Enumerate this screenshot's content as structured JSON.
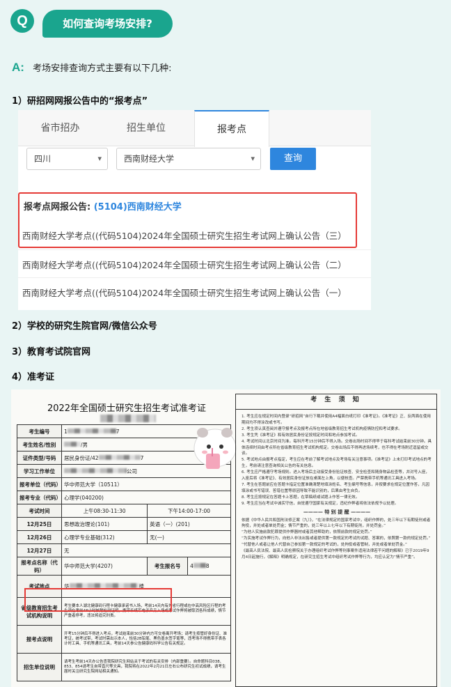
{
  "header": {
    "q_mark": "Q",
    "question": "如何查询考场安排?"
  },
  "answer": {
    "a_mark": "A:",
    "text": "考场安排查询方式主要有以下几种:"
  },
  "steps": {
    "s1": "1）研招网网报公告中的“报考点”",
    "s2": "2）学校的研究生院官网/微信公众号",
    "s3": "3）教育考试院官网",
    "s4": "4）准考证"
  },
  "portal": {
    "tabs": [
      "省市招办",
      "招生单位",
      "报考点"
    ],
    "active_tab": 2,
    "province": "四川",
    "school": "西南财经大学",
    "query_button": "查询",
    "notice_label": "报考点网报公告:",
    "notice_code": "(5104)西南财经大学",
    "notices": [
      "西南财经大学考点((代码5104)2024年全国硕士研究生招生考试网上确认公告（三）",
      "西南财经大学考点((代码5104)2024年全国硕士研究生招生考试网上确认公告（二）",
      "西南财经大学考点((代码5104)2024年全国硕士研究生招生考试网上确认公告（一）"
    ]
  },
  "ticket": {
    "title": "2022年全国硕士研究生招生考试准考证",
    "rows": {
      "exam_no_label": "考生编号",
      "exam_no": "1",
      "exam_no_tail": "7",
      "name_label": "考生姓名/性别",
      "name_tail": "/男",
      "id_label": "证件类型/号码",
      "id_value": "居民身份证/42",
      "id_tail": "7",
      "work_label": "学习工作单位",
      "work_tail": "公司",
      "unit_label": "报考单位（代码）",
      "unit_value": "华中师范大学（10511）",
      "major_label": "报考专业（代码）",
      "major_value": "心理学(040200)",
      "time_label": "考试时间",
      "am": "上午08:30-11:30",
      "pm": "下午14:00-17:00",
      "d1": "12月25日",
      "d1_am": "思想政治理论(101)",
      "d1_pm": "英语（一）(201)",
      "d2": "12月26日",
      "d2_am": "心理学专业基础(312)",
      "d2_pm": "无(一)",
      "d3": "12月27日",
      "d3_am": "无",
      "site_unit_label": "报考点名称（代码）",
      "site_unit": "华中师范大学(4207)",
      "reg_label": "考生报名号",
      "reg_value": "4",
      "reg_tail": "8",
      "site_label": "考试地点",
      "site_value": "华",
      "site_tail": "楼",
      "prov_label": "省级教育招生考试机构说明",
      "prov_text": "考生要本人湖北健康码行程卡健康承诺书入场，考前14天内有外省行程或在中高风险区行程的考生须在考前48小时核酸检测证明，携带千纸军电子产品入场或考试作弊将被取消各科成绩，情节严重者停考，违法将追究刑责。",
      "site_note_label": "报考点说明",
      "site_note_text": "开考15分钟后不得进入考点，考试结束前30分钟内方可交卷离开考场；请考生按管好身份证、准考证，统考试带，考试时需出示本人，恰括2B铅笔、黑色墨水签字笔等，违考场不得携带手表各计时工具、手机等通讯工具，考前14天参公告健康码科学公告有关规定。",
      "zs_label": "招生单位说明",
      "zs_text": "请考生考前14天办公告查我院研究生网站关于考试的有关安排（内部重要）。自命题科目038、853、854请考生自带直尺等文具，我院将在2022年2月21日左右公布研究生初试成绩，请考生届时关注研究生院网站相关通知。"
    },
    "notice_header": "考 生 须 知",
    "notice_items": [
      "1. 考生应在规定时间内登录“研招网”自行下载并使用A4幅面白纸打印《准考证》。《准考证》正、反两面在使用期间均不得涂改或书写。",
      "2. 考生须认真查阅并遵守报考点及报考点所在地省级教育招生考试机构疫情防控和考试要求。",
      "3. 考生凭《准考证》和有效居民身份证按规定时间和地点参加考试。",
      "4. 考试时间以北京时间为准。每科开考15分钟后不得入场。交卷出场时间不得早于每科考试结束前30分钟。具体连续时间由考点所在省级教育招生考试机构规定。交卷出场后不得再进场续考，也不得在考场附近逗留或交谈。",
      "5. 考试地点由报考点指定，考生应在考前了解考试地点及考场有关注意事项。《准考证》上未打印考试地点的考生，考前请注意查询相关公告的有关信息。",
      "6. 考生应严格遵守考场规则。进入考场后主动接受身份验证核查、安全检查和随身物品检查等，并对号入座，入座后将《准考证》、有效居民身份证放在桌面左上角，以便核查。严禁携带手机等通讯工具进入考场。",
      "7. 考生在答题前应在答题卡指定位置准确清楚地填涂姓名、考生编号等信息，并按要求在规定位置作答，凡因填涂或书写错误、答错位置等原因导致不能识别的，后果由考生自负。",
      "8. 考生应按规定在答题卡上答题，在草稿纸或试题上作答一律无效。",
      "9. 考生应当在考试中诚实守信，自觉遵守国家有关规定，违纪作弊者将依法依规予以处理。"
    ],
    "special_header": "———— 特 别 提 醒 ————",
    "special_items": [
      "依据《中华人民共和国刑法修正案（九）》，“在法律规定的国家考试中，组织作弊的，处三年以下有期徒刑或者拘役，并处或者单处罚金；情节严重的，处三年以上七年以下有期徒刑，并处罚金。”",
      "“为他人实施前款犯罪提供作弊器材或者其他帮助的，依照前款的规定处罚。”",
      "“为实施考试作弊行为，向他人非法出售或者提供第一款规定的考试的试题、答案的，依照第一款的规定处罚。”",
      "“代替他人或者让他人代替自己参加第一款规定的考试的，处拘役或者管制，并处或者单处罚金。”",
      "《最高人民法院、最高人民检察院关于办理组织考试作弊等刑事案件适用法律若干问题的解释》已于2019年9月4日起施行，《解释》明确规定，在研究生招生考试中组织考试作弊等行为，均应认定为“情节严重”。"
    ]
  }
}
